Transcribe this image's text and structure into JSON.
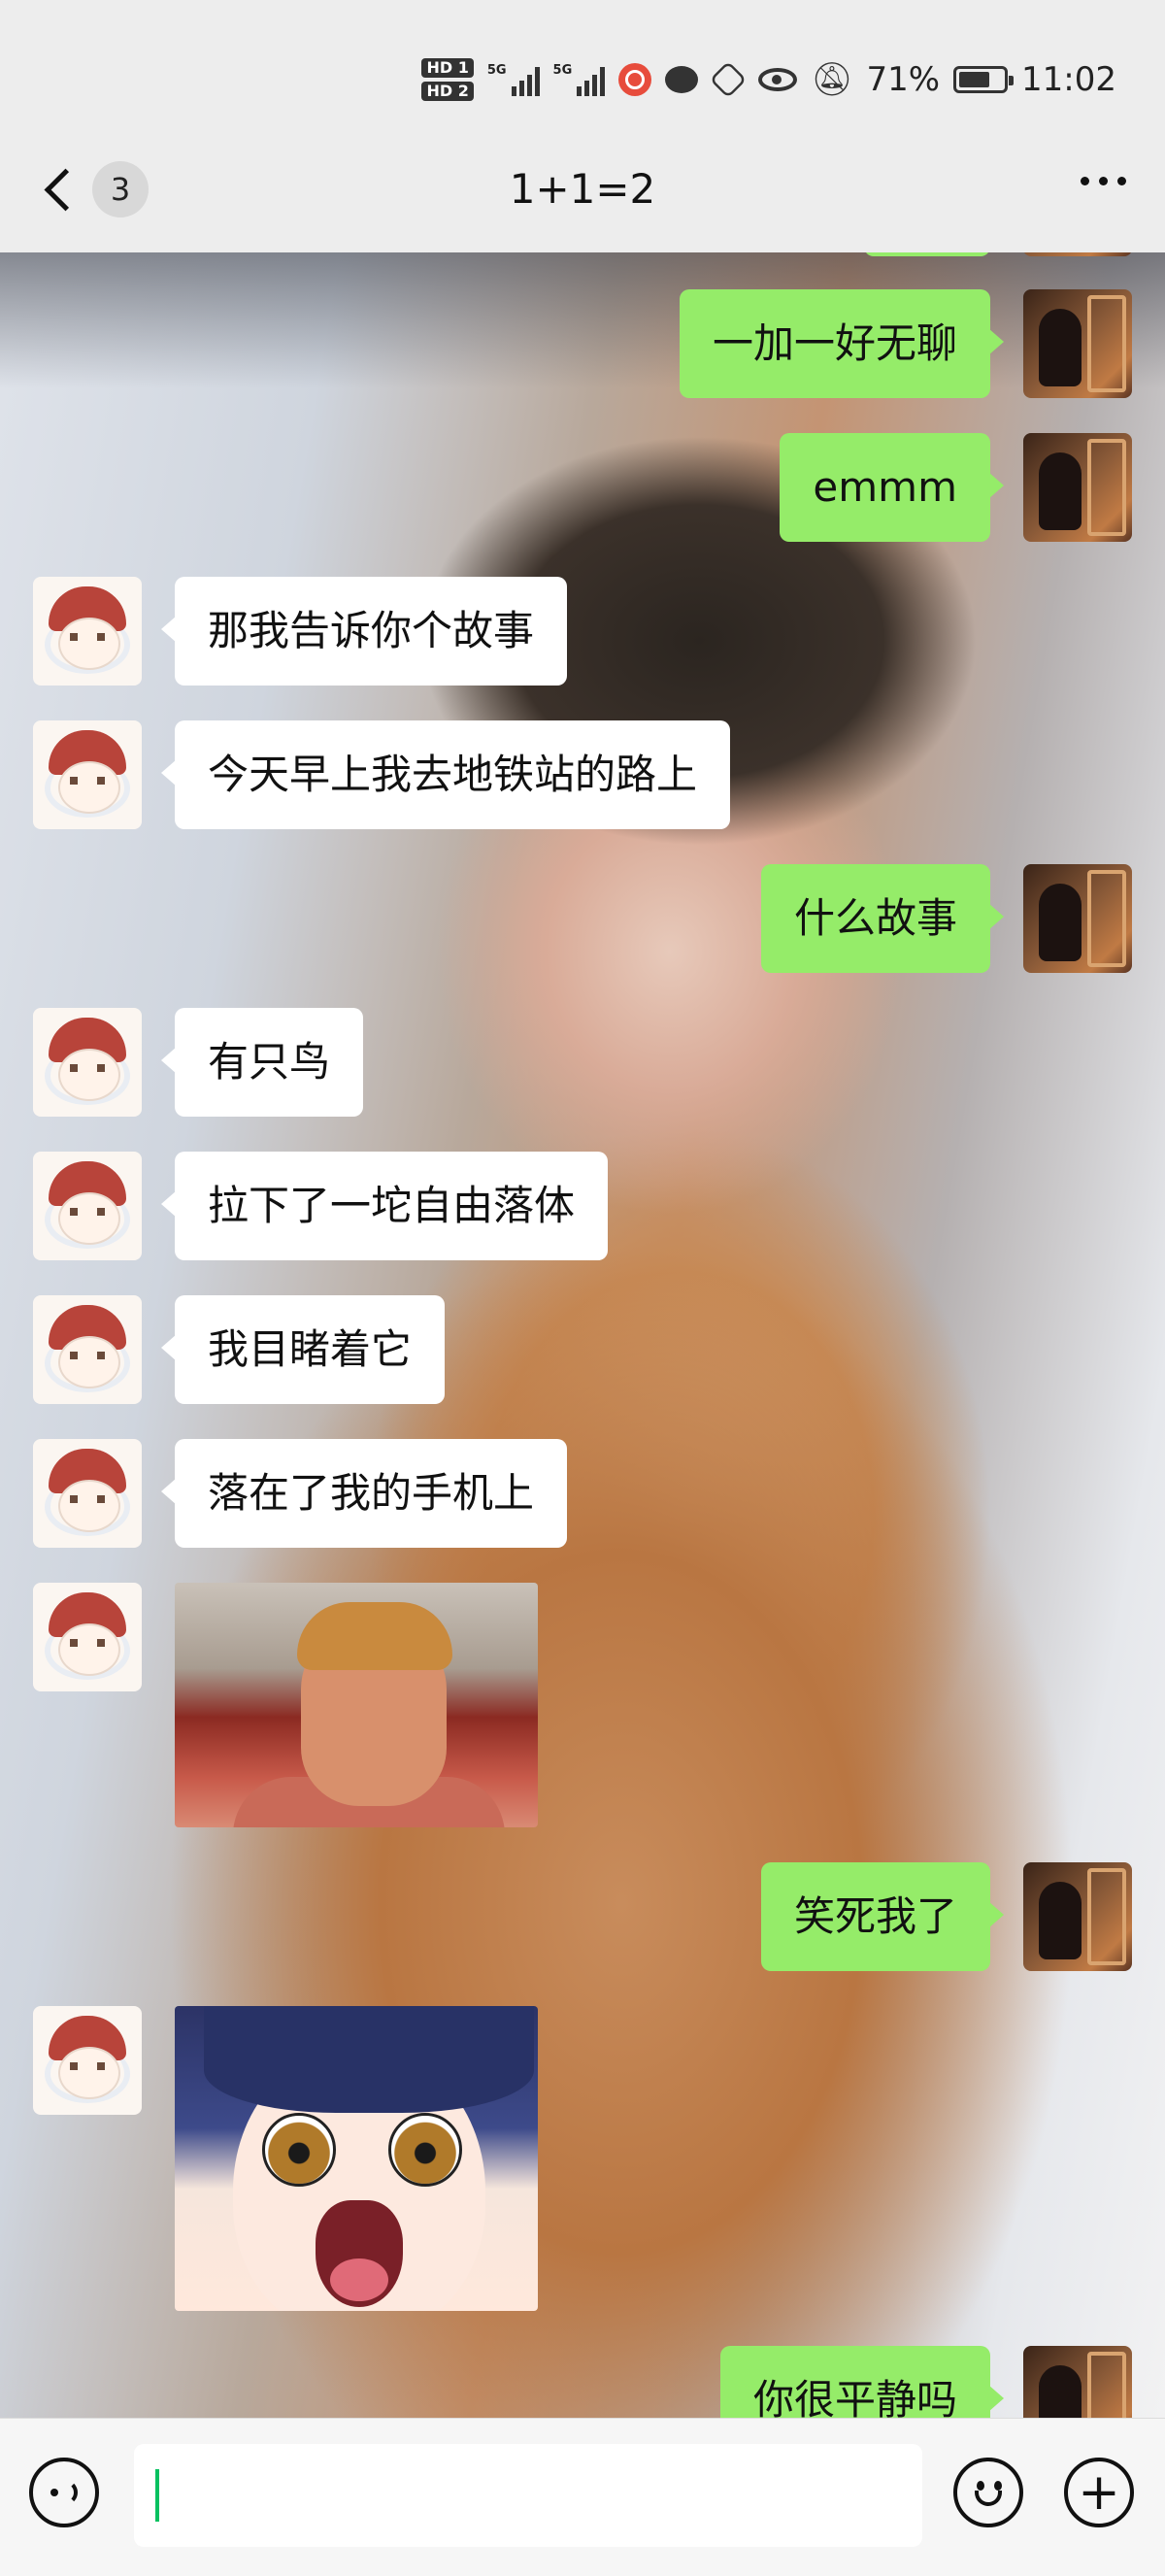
{
  "status_bar": {
    "hd1": "HD 1",
    "hd2": "HD 2",
    "sim1_label": "5G",
    "sim2_label": "5G",
    "battery": "71%",
    "battery_level": 0.71,
    "time": "11:02"
  },
  "nav": {
    "unread_count": "3",
    "title": "1+1=2"
  },
  "messages": [
    {
      "side": "right",
      "type": "text",
      "text": "一加一好无聊"
    },
    {
      "side": "right",
      "type": "text",
      "text": "emmm"
    },
    {
      "side": "left",
      "type": "text",
      "text": "那我告诉你个故事"
    },
    {
      "side": "left",
      "type": "text",
      "text": "今天早上我去地铁站的路上"
    },
    {
      "side": "right",
      "type": "text",
      "text": "什么故事"
    },
    {
      "side": "left",
      "type": "text",
      "text": "有只鸟"
    },
    {
      "side": "left",
      "type": "text",
      "text": "拉下了一坨自由落体"
    },
    {
      "side": "left",
      "type": "text",
      "text": "我目睹着它"
    },
    {
      "side": "left",
      "type": "text",
      "text": "落在了我的手机上"
    },
    {
      "side": "left",
      "type": "sticker",
      "sticker": "man-stare-sticker"
    },
    {
      "side": "right",
      "type": "text",
      "text": "笑死我了"
    },
    {
      "side": "left",
      "type": "sticker",
      "sticker": "anime-shock-sticker"
    },
    {
      "side": "right",
      "type": "text",
      "text": "你很平静吗"
    }
  ],
  "input": {
    "value": "",
    "placeholder": ""
  },
  "colors": {
    "sent_bubble": "#95ec69",
    "received_bubble": "#ffffff",
    "bar_background": "#ededed",
    "caret": "#07c160"
  },
  "icons": [
    "back-chevron-icon",
    "more-icon",
    "voice-icon",
    "emoji-icon",
    "plus-icon",
    "eye-icon",
    "mute-bell-icon",
    "battery-icon"
  ]
}
